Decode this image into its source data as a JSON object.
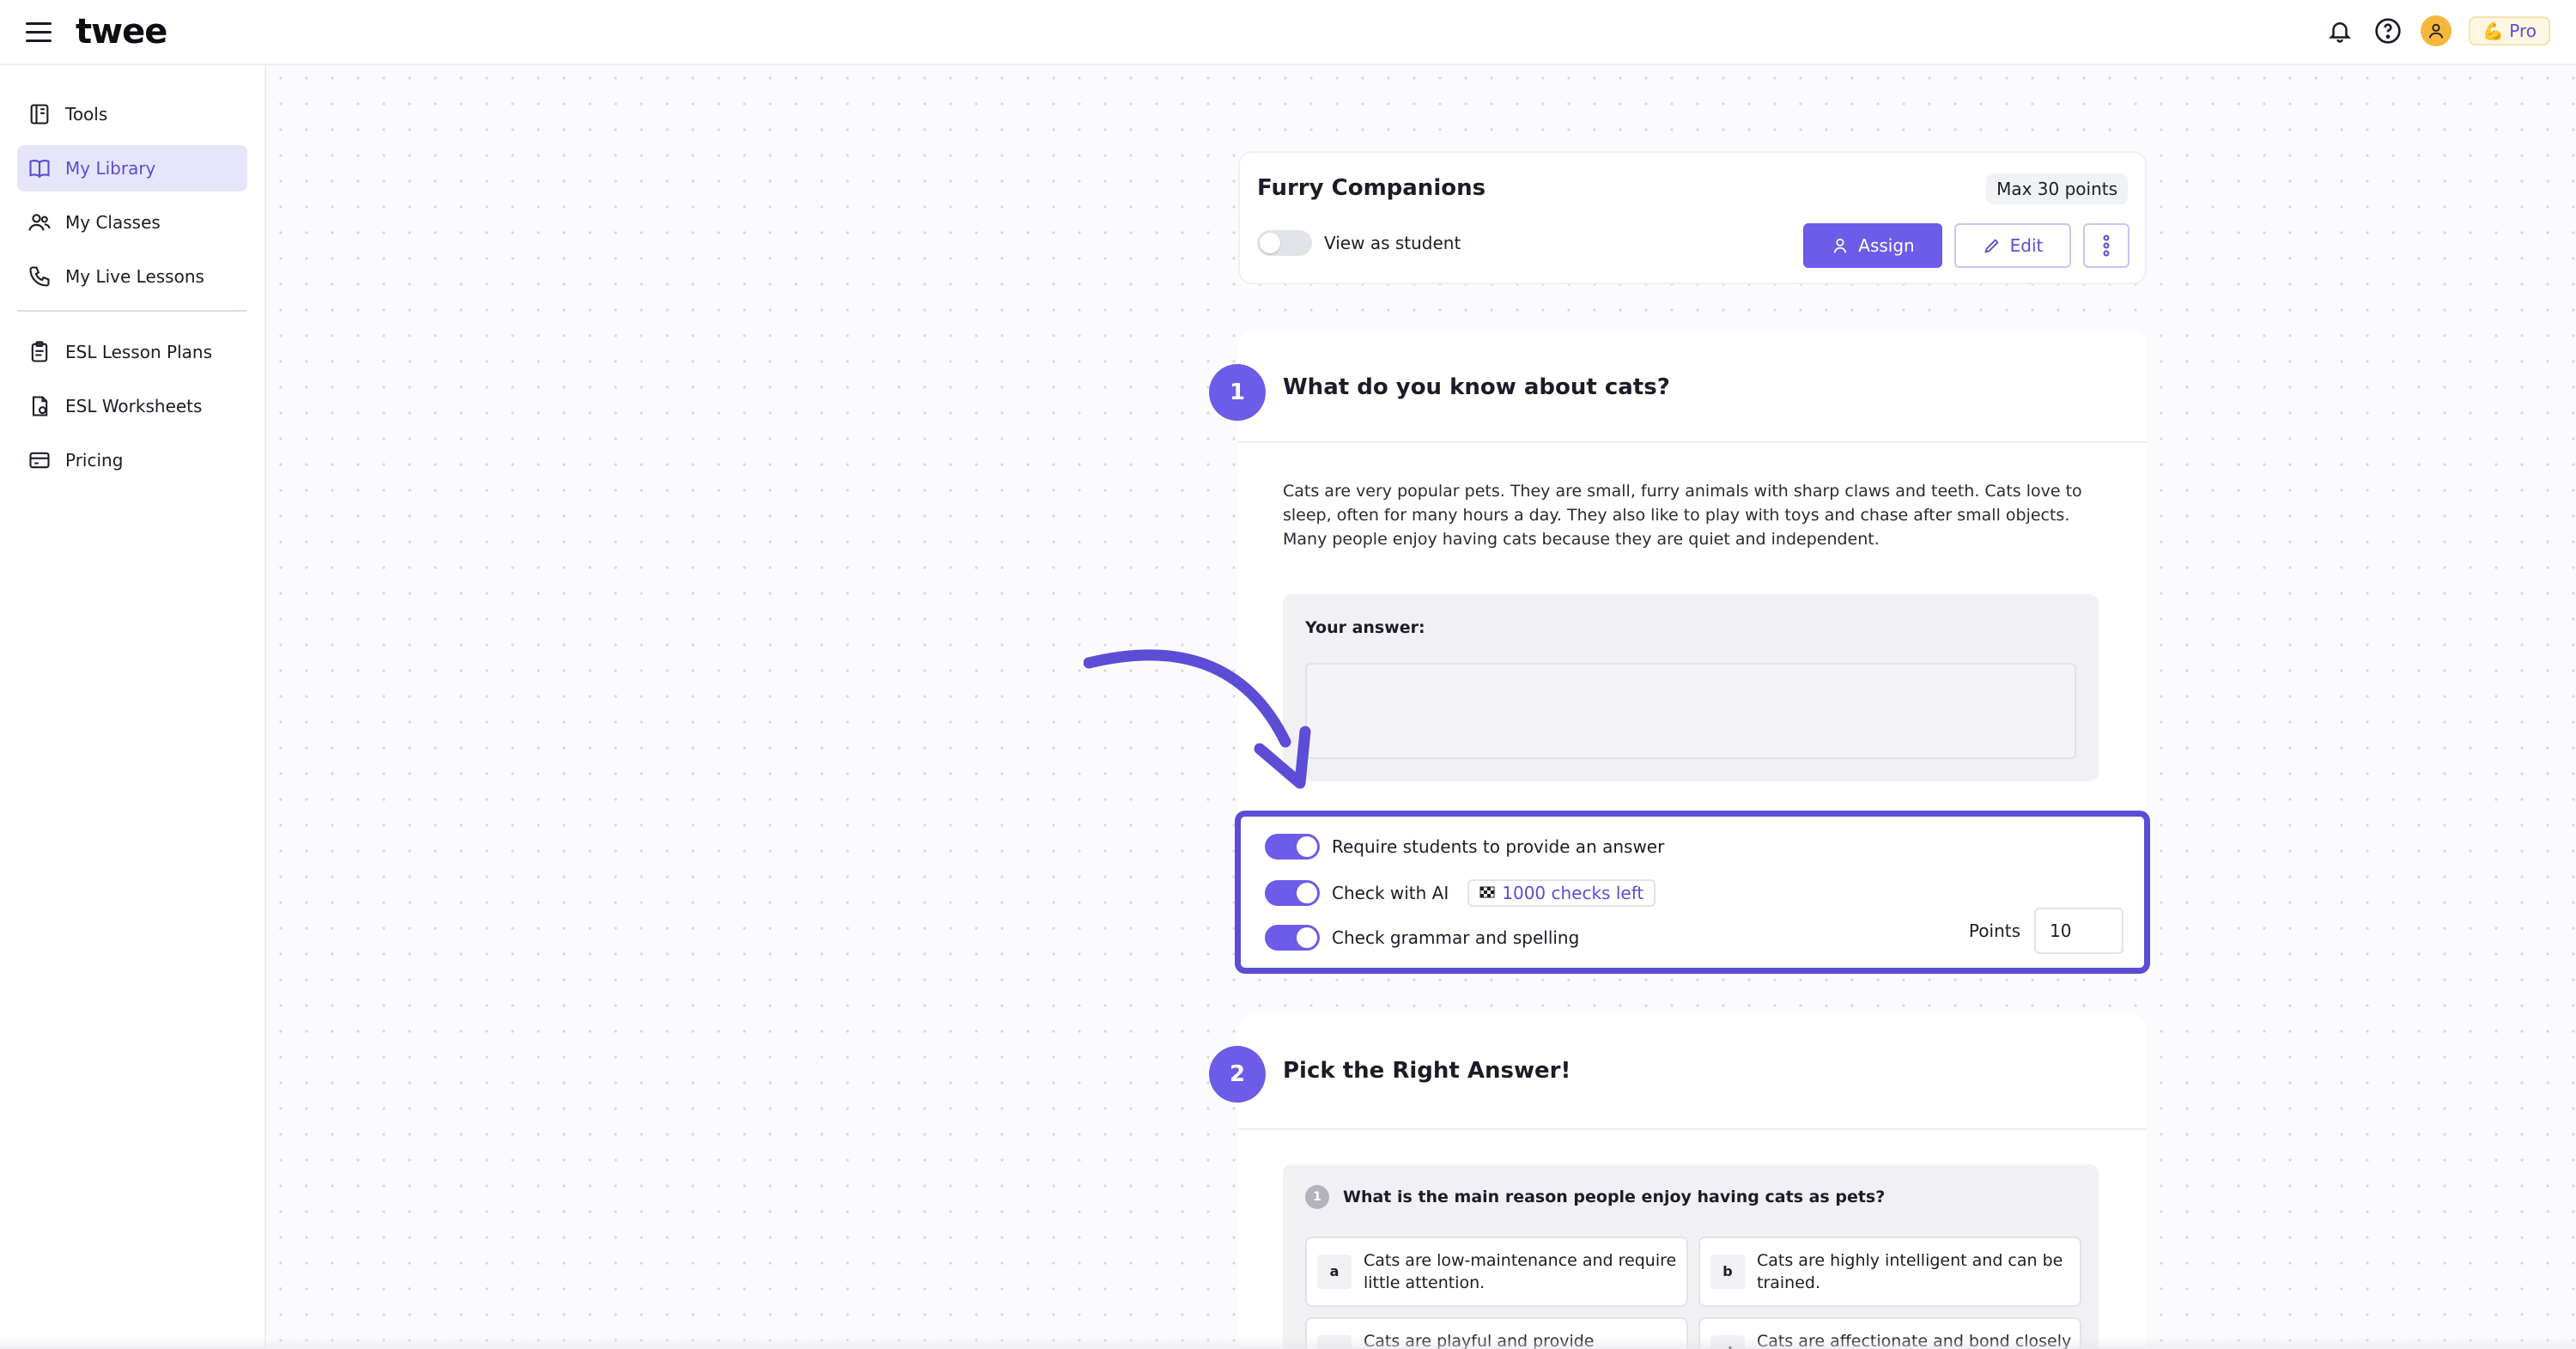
{
  "app": {
    "logo": "twee",
    "pro_label": "Pro",
    "pro_emoji": "💪"
  },
  "icons": {
    "menu": "hamburger-icon",
    "notifications": "bell-icon",
    "help": "help-icon",
    "profile": "user-icon"
  },
  "colors": {
    "accent": "#6c5ce7",
    "accent_dark": "#5b4dd6",
    "active_bg": "#e7e5fb"
  },
  "sidebar": {
    "items": [
      {
        "label": "Tools",
        "icon": "tools-icon"
      },
      {
        "label": "My Library",
        "icon": "book-icon",
        "active": true
      },
      {
        "label": "My Classes",
        "icon": "users-icon"
      },
      {
        "label": "My Live Lessons",
        "icon": "phone-icon"
      },
      {
        "label": "ESL Lesson Plans",
        "icon": "clipboard-icon"
      },
      {
        "label": "ESL Worksheets",
        "icon": "worksheet-icon"
      },
      {
        "label": "Pricing",
        "icon": "card-icon"
      }
    ]
  },
  "header": {
    "title": "Furry Companions",
    "max_points": "Max 30 points",
    "view_as_student": "View as student",
    "assign": "Assign",
    "edit": "Edit"
  },
  "question1": {
    "number": "1",
    "title": "What do you know about cats?",
    "text": "Cats are very popular pets. They are small, furry animals with sharp claws and teeth. Cats love to sleep, often for many hours a day. They also like to play with toys and chase after small objects. Many people enjoy having cats because they are quiet and independent.",
    "answer_label": "Your answer:"
  },
  "settings": {
    "require_answer": "Require students to provide an answer",
    "check_ai": "Check with AI",
    "checks_left": "1000 checks left",
    "check_grammar": "Check grammar and spelling",
    "points_label": "Points",
    "points_value": "10"
  },
  "question2": {
    "number": "2",
    "title": "Pick the Right Answer!",
    "sub_number": "1",
    "prompt": "What is the main reason people enjoy having cats as pets?",
    "options": [
      {
        "letter": "a",
        "text": "Cats are low-maintenance and require little attention."
      },
      {
        "letter": "b",
        "text": "Cats are highly intelligent and can be trained."
      },
      {
        "letter": "c",
        "text": "Cats are playful and provide entertainment."
      },
      {
        "letter": "d",
        "text": "Cats are affectionate and bond closely with their owners."
      }
    ]
  }
}
